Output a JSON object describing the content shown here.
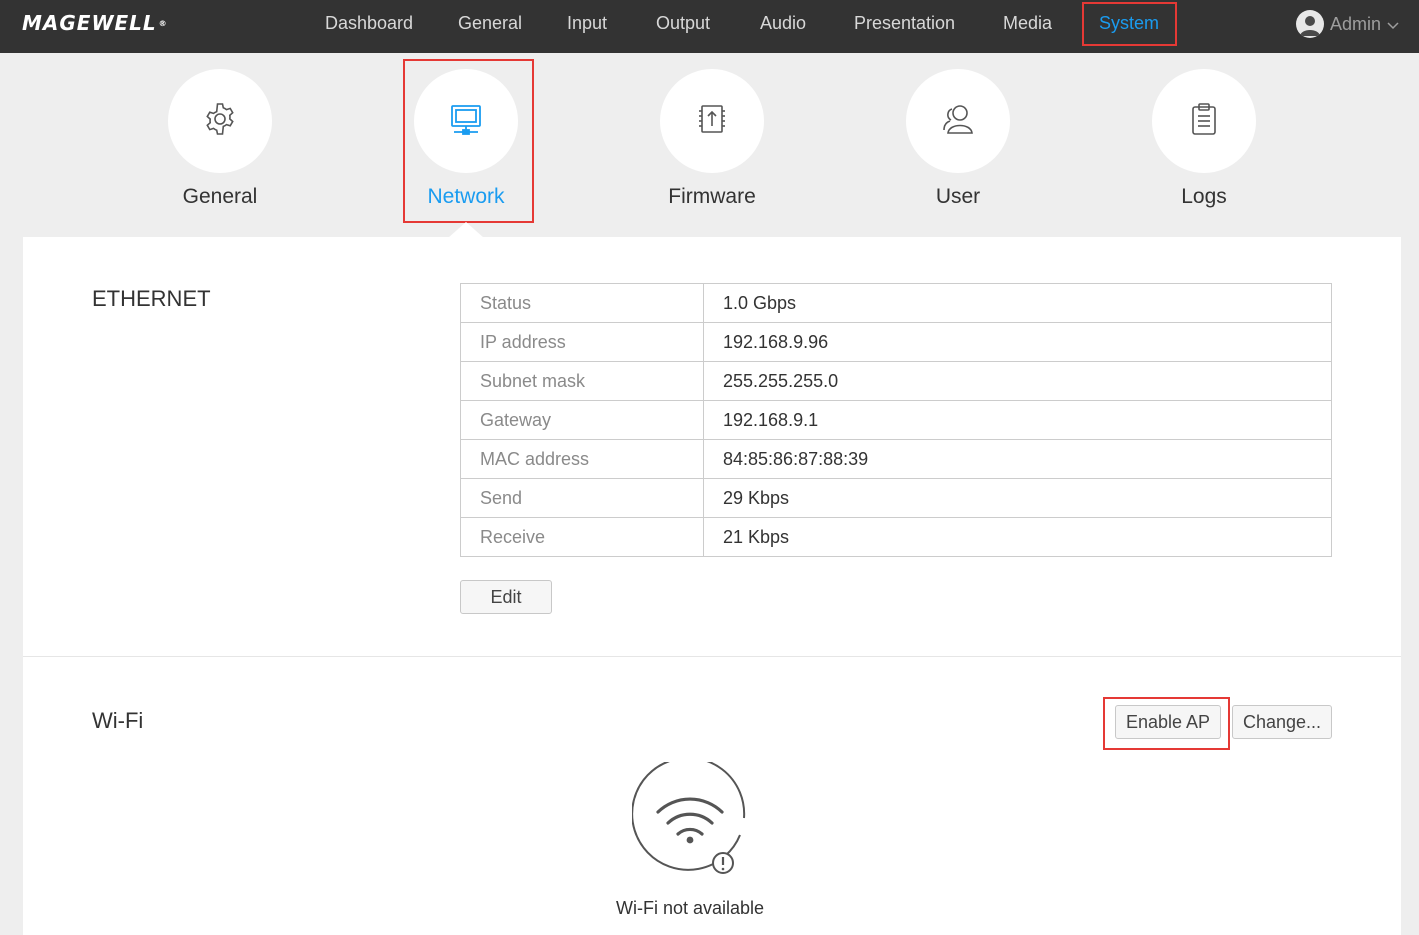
{
  "brand": {
    "logo_text": "MAGEWELL",
    "logo_mark": "®"
  },
  "topnav": {
    "items": [
      {
        "label": "Dashboard"
      },
      {
        "label": "General"
      },
      {
        "label": "Input"
      },
      {
        "label": "Output"
      },
      {
        "label": "Audio"
      },
      {
        "label": "Presentation"
      },
      {
        "label": "Media"
      },
      {
        "label": "System"
      }
    ],
    "active": "System",
    "user": {
      "label": "Admin",
      "icon": "user-avatar-icon",
      "chevron": "chevron-down-icon"
    }
  },
  "subnav": {
    "items": [
      {
        "label": "General",
        "icon": "gear-icon"
      },
      {
        "label": "Network",
        "icon": "monitor-network-icon"
      },
      {
        "label": "Firmware",
        "icon": "chip-upload-icon"
      },
      {
        "label": "User",
        "icon": "users-icon"
      },
      {
        "label": "Logs",
        "icon": "clipboard-icon"
      }
    ],
    "active": "Network"
  },
  "ethernet": {
    "title": "ETHERNET",
    "rows": [
      {
        "key": "Status",
        "value": "1.0 Gbps"
      },
      {
        "key": "IP address",
        "value": "192.168.9.96"
      },
      {
        "key": "Subnet mask",
        "value": "255.255.255.0"
      },
      {
        "key": "Gateway",
        "value": "192.168.9.1"
      },
      {
        "key": "MAC address",
        "value": "84:85:86:87:88:39"
      },
      {
        "key": "Send",
        "value": "29 Kbps"
      },
      {
        "key": "Receive",
        "value": "21 Kbps"
      }
    ],
    "edit_label": "Edit"
  },
  "wifi": {
    "title": "Wi-Fi",
    "enable_ap_label": "Enable AP",
    "change_label": "Change...",
    "empty_icon": "wifi-warning-icon",
    "empty_text": "Wi-Fi not available"
  },
  "colors": {
    "topbar": "#333333",
    "accent": "#1a9cf0",
    "highlight": "#e53935",
    "page_bg": "#eeeeee"
  }
}
